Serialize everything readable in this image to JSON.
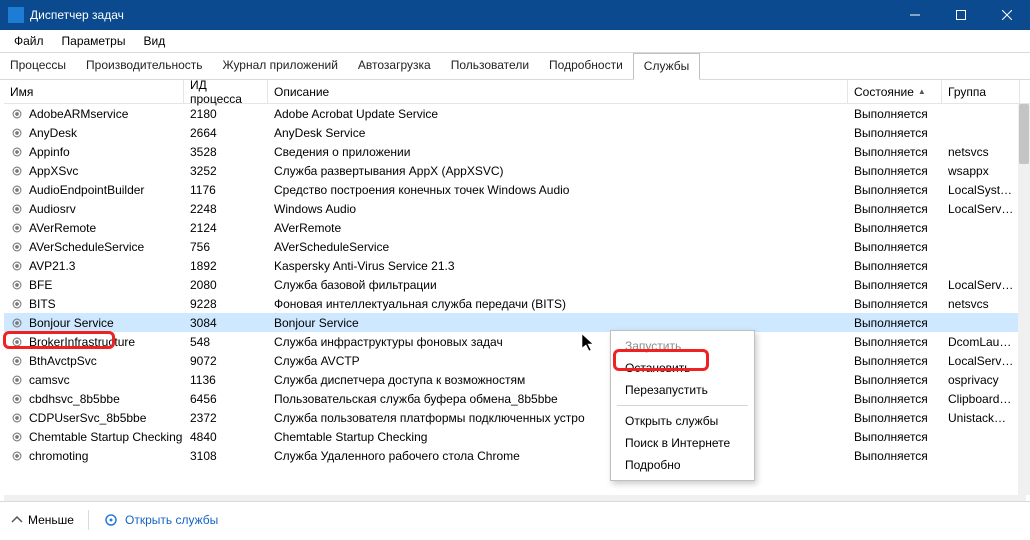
{
  "window": {
    "title": "Диспетчер задач"
  },
  "menu": {
    "file": "Файл",
    "options": "Параметры",
    "view": "Вид"
  },
  "tabs": [
    "Процессы",
    "Производительность",
    "Журнал приложений",
    "Автозагрузка",
    "Пользователи",
    "Подробности",
    "Службы"
  ],
  "active_tab_index": 6,
  "columns": {
    "name": "Имя",
    "pid": "ИД процесса",
    "desc": "Описание",
    "state": "Состояние",
    "group": "Группа"
  },
  "sort_indicator": "▲",
  "rows": [
    {
      "name": "AdobeARMservice",
      "pid": "2180",
      "desc": "Adobe Acrobat Update Service",
      "state": "Выполняется",
      "group": ""
    },
    {
      "name": "AnyDesk",
      "pid": "2664",
      "desc": "AnyDesk Service",
      "state": "Выполняется",
      "group": ""
    },
    {
      "name": "Appinfo",
      "pid": "3528",
      "desc": "Сведения о приложении",
      "state": "Выполняется",
      "group": "netsvcs"
    },
    {
      "name": "AppXSvc",
      "pid": "3252",
      "desc": "Служба развертывания AppX (AppXSVC)",
      "state": "Выполняется",
      "group": "wsappx"
    },
    {
      "name": "AudioEndpointBuilder",
      "pid": "1176",
      "desc": "Средство построения конечных точек Windows Audio",
      "state": "Выполняется",
      "group": "LocalSystem"
    },
    {
      "name": "Audiosrv",
      "pid": "2248",
      "desc": "Windows Audio",
      "state": "Выполняется",
      "group": "LocalService"
    },
    {
      "name": "AVerRemote",
      "pid": "2124",
      "desc": "AVerRemote",
      "state": "Выполняется",
      "group": ""
    },
    {
      "name": "AVerScheduleService",
      "pid": "756",
      "desc": "AVerScheduleService",
      "state": "Выполняется",
      "group": ""
    },
    {
      "name": "AVP21.3",
      "pid": "1892",
      "desc": "Kaspersky Anti-Virus Service 21.3",
      "state": "Выполняется",
      "group": ""
    },
    {
      "name": "BFE",
      "pid": "2080",
      "desc": "Служба базовой фильтрации",
      "state": "Выполняется",
      "group": "LocalService"
    },
    {
      "name": "BITS",
      "pid": "9228",
      "desc": "Фоновая интеллектуальная служба передачи (BITS)",
      "state": "Выполняется",
      "group": "netsvcs"
    },
    {
      "name": "Bonjour Service",
      "pid": "3084",
      "desc": "Bonjour Service",
      "state": "Выполняется",
      "group": "",
      "selected": true
    },
    {
      "name": "BrokerInfrastructure",
      "pid": "548",
      "desc": "Служба инфраструктуры фоновых задач",
      "state": "Выполняется",
      "group": "DcomLaunch"
    },
    {
      "name": "BthAvctpSvc",
      "pid": "9072",
      "desc": "Служба AVCTP",
      "state": "Выполняется",
      "group": "LocalService"
    },
    {
      "name": "camsvc",
      "pid": "1136",
      "desc": "Служба диспетчера доступа к возможностям",
      "state": "Выполняется",
      "group": "osprivacy"
    },
    {
      "name": "cbdhsvc_8b5bbe",
      "pid": "6456",
      "desc": "Пользовательская служба буфера обмена_8b5bbe",
      "state": "Выполняется",
      "group": "ClipboardSvc"
    },
    {
      "name": "CDPUserSvc_8b5bbe",
      "pid": "2372",
      "desc": "Служба пользователя платформы подключенных устро",
      "state": "Выполняется",
      "group": "UnistackSvc"
    },
    {
      "name": "Chemtable Startup Checking",
      "pid": "4840",
      "desc": "Chemtable Startup Checking",
      "state": "Выполняется",
      "group": ""
    },
    {
      "name": "chromoting",
      "pid": "3108",
      "desc": "Служба Удаленного рабочего стола Chrome",
      "state": "Выполняется",
      "group": ""
    }
  ],
  "context_menu": {
    "start": "Запустить",
    "stop": "Остановить",
    "restart": "Перезапустить",
    "open": "Открыть службы",
    "search": "Поиск в Интернете",
    "details": "Подробно"
  },
  "footer": {
    "fewer": "Меньше",
    "open_services": "Открыть службы"
  }
}
